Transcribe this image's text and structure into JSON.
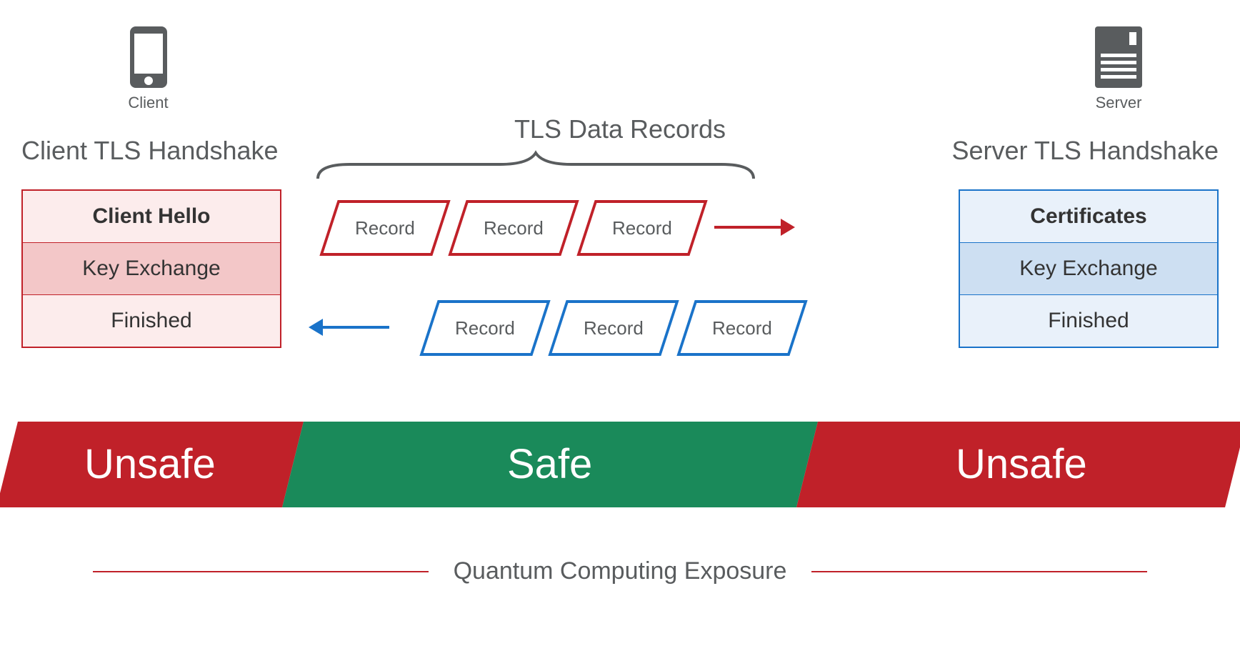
{
  "client": {
    "icon_label": "Client",
    "title": "Client TLS Handshake",
    "rows": [
      "Client Hello",
      "Key Exchange",
      "Finished"
    ]
  },
  "server": {
    "icon_label": "Server",
    "title": "Server TLS Handshake",
    "rows": [
      "Certificates",
      "Key Exchange",
      "Finished"
    ]
  },
  "records": {
    "title": "TLS Data Records",
    "label": "Record"
  },
  "safety": {
    "left": "Unsafe",
    "mid": "Safe",
    "right": "Unsafe"
  },
  "exposure": "Quantum Computing Exposure"
}
